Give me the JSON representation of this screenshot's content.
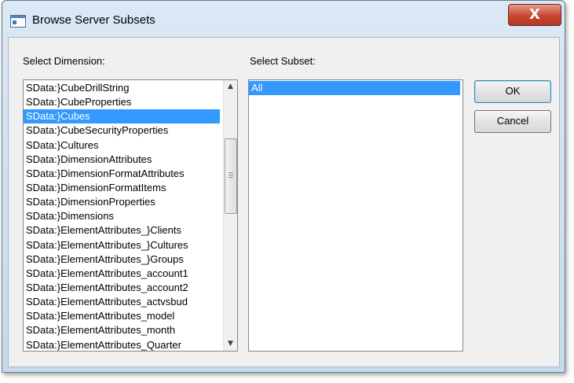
{
  "window": {
    "title": "Browse Server Subsets",
    "close_glyph": "X"
  },
  "dimension": {
    "label": "Select Dimension:",
    "items": [
      "SData:}CubeDrillString",
      "SData:}CubeProperties",
      "SData:}Cubes",
      "SData:}CubeSecurityProperties",
      "SData:}Cultures",
      "SData:}DimensionAttributes",
      "SData:}DimensionFormatAttributes",
      "SData:}DimensionFormatItems",
      "SData:}DimensionProperties",
      "SData:}Dimensions",
      "SData:}ElementAttributes_}Clients",
      "SData:}ElementAttributes_}Cultures",
      "SData:}ElementAttributes_}Groups",
      "SData:}ElementAttributes_account1",
      "SData:}ElementAttributes_account2",
      "SData:}ElementAttributes_actvsbud",
      "SData:}ElementAttributes_model",
      "SData:}ElementAttributes_month",
      "SData:}ElementAttributes_Quarter"
    ],
    "selected": "SData:}Cubes"
  },
  "subset": {
    "label": "Select Subset:",
    "items": [
      "All"
    ],
    "selected": "All"
  },
  "buttons": {
    "ok": "OK",
    "cancel": "Cancel"
  },
  "icons": {
    "app": "dialog-window-icon",
    "close": "close-icon",
    "scroll_up": "scroll-up-arrow-icon",
    "scroll_down": "scroll-down-arrow-icon"
  },
  "colors": {
    "selection": "#3399ff",
    "close_button": "#c7452f"
  }
}
